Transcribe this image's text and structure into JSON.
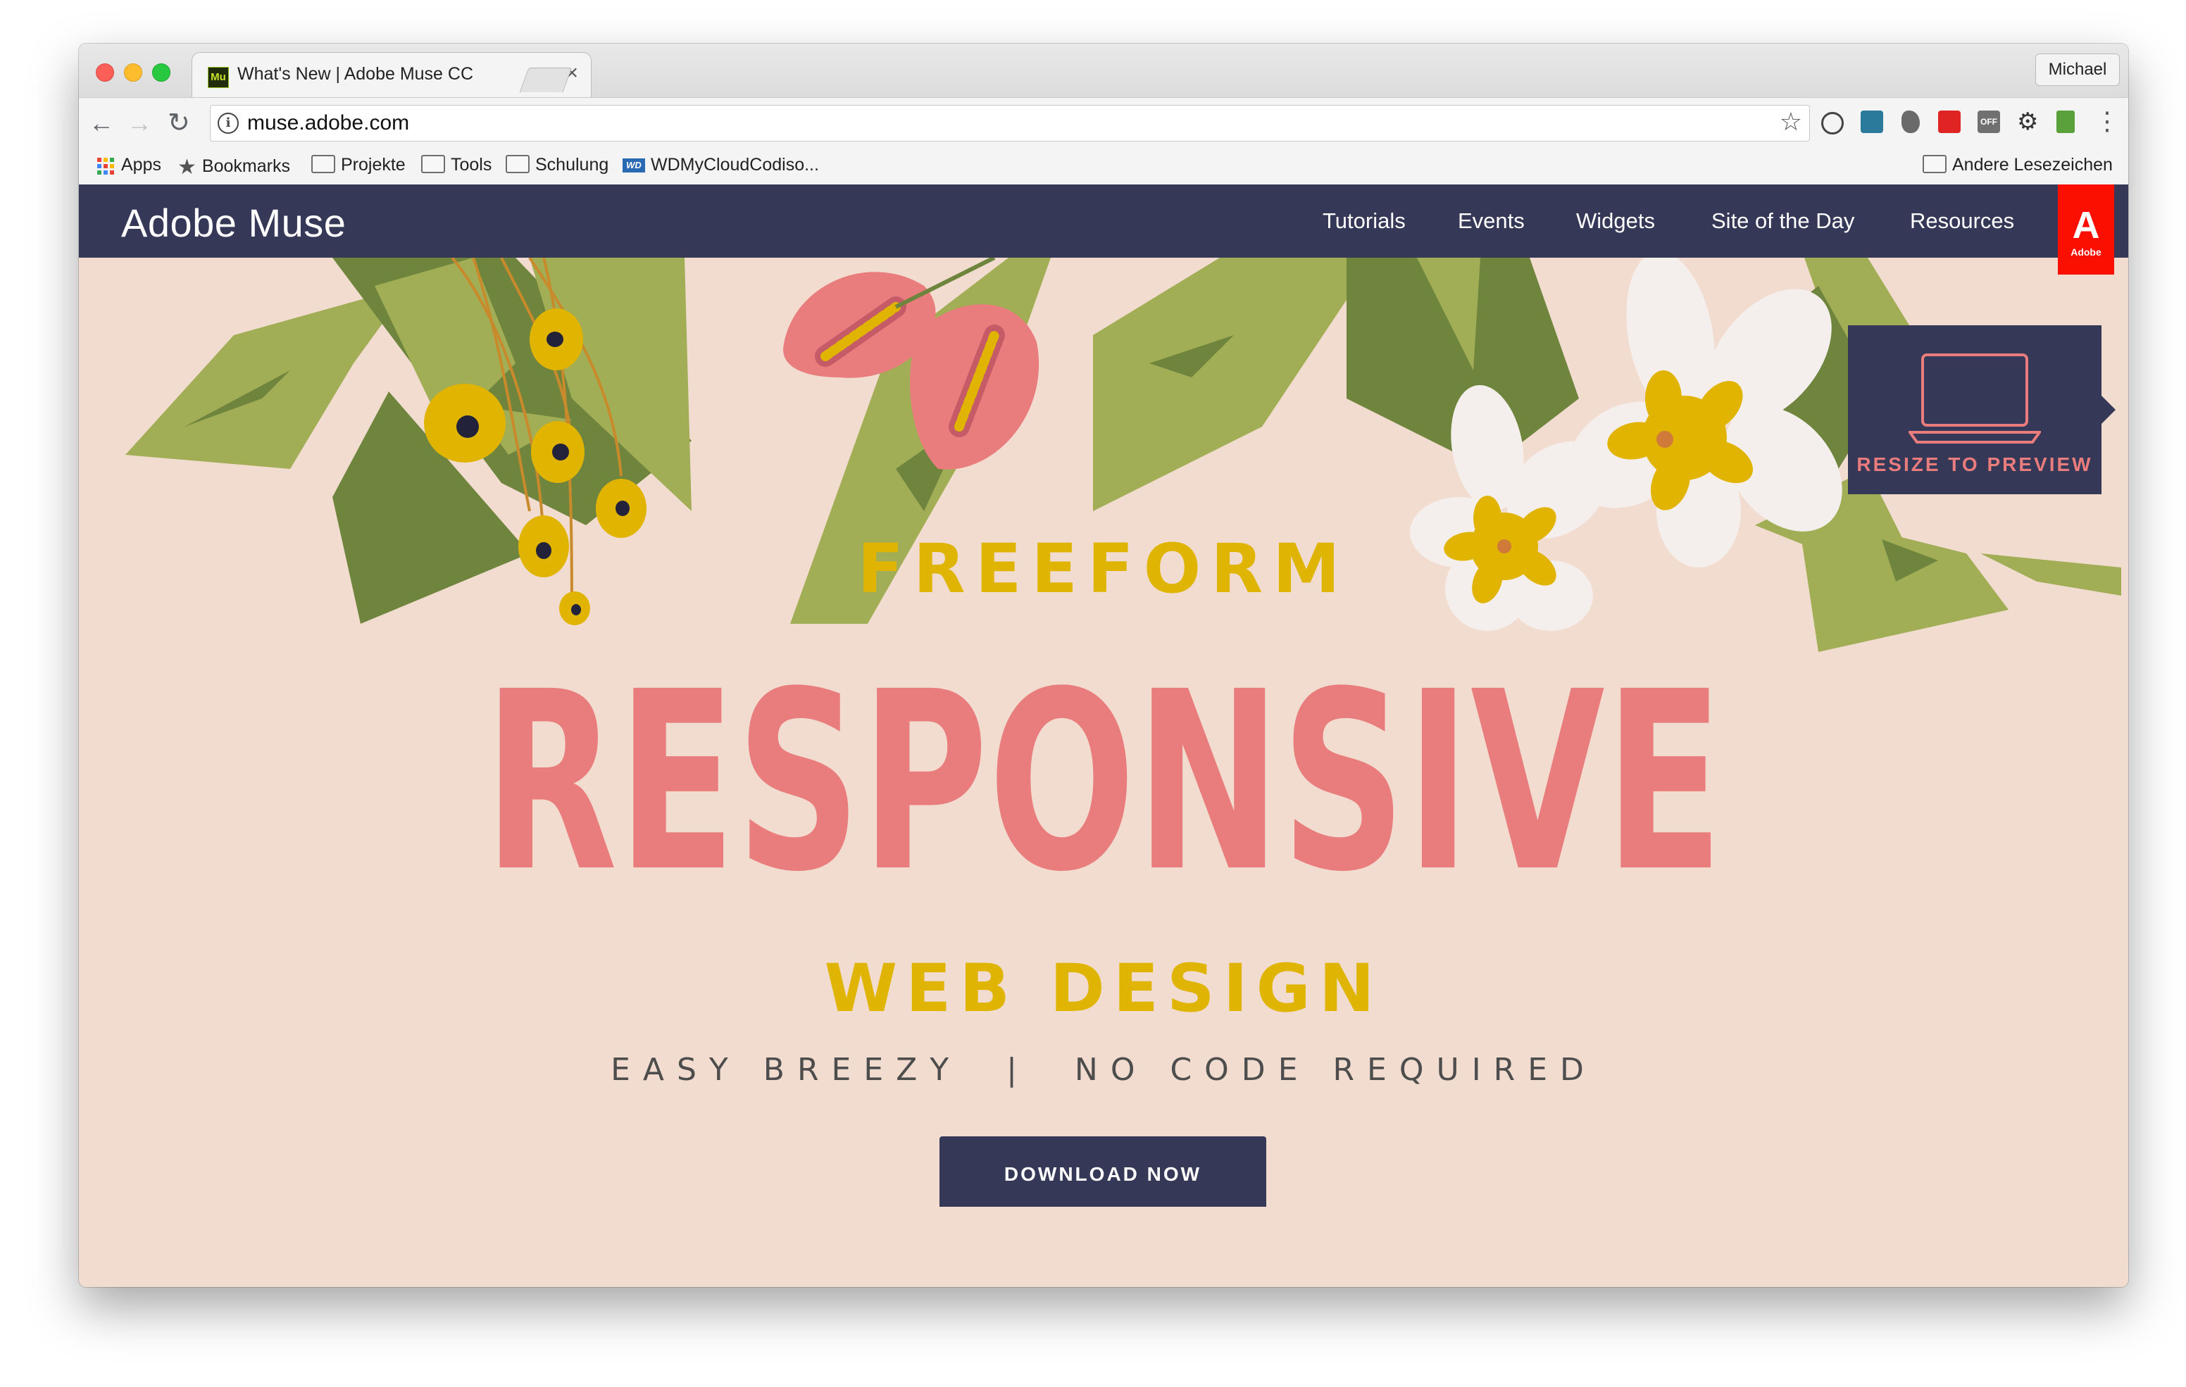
{
  "browser": {
    "tab": {
      "favicon_text": "Mu",
      "title": "What's New | Adobe Muse CC",
      "close": "×"
    },
    "profile": "Michael",
    "address": {
      "url": "muse.adobe.com",
      "info_icon": "i"
    },
    "nav": {
      "back": "←",
      "forward": "→",
      "reload": "↻",
      "bookmark_star": "☆",
      "menu": "⋮"
    },
    "extensions": {
      "off_label": "OFF",
      "gear": "⚙"
    },
    "bookmarks": {
      "items": [
        {
          "label": "Apps",
          "icon": "apps-grid-icon"
        },
        {
          "label": "Bookmarks",
          "icon": "star-icon"
        },
        {
          "label": "Projekte",
          "icon": "folder-icon"
        },
        {
          "label": "Tools",
          "icon": "folder-icon"
        },
        {
          "label": "Schulung",
          "icon": "folder-icon"
        },
        {
          "label": "WDMyCloudCodiso...",
          "icon": "wd-icon"
        }
      ],
      "other": "Andere Lesezeichen",
      "wd_icon_text": "WD"
    }
  },
  "site": {
    "brand": "Adobe Muse",
    "nav": [
      "Tutorials",
      "Events",
      "Widgets",
      "Site of the Day",
      "Resources"
    ],
    "adobe_logo": {
      "glyph": "A",
      "word": "Adobe"
    },
    "resize_card": "RESIZE TO PREVIEW",
    "hero": {
      "line1": "FREEFORM",
      "line2": "RESPONSIVE",
      "line3": "WEB DESIGN",
      "tagline": "EASY BREEZY  |  NO CODE REQUIRED",
      "cta": "DOWNLOAD NOW"
    }
  },
  "colors": {
    "nav_bg": "#363858",
    "hero_bg": "#f2dccf",
    "pink": "#e97c7c",
    "gold": "#dfb403",
    "leaf_light": "#a2ae55",
    "leaf_dark": "#6f853e",
    "adobe_red": "#fa0f00"
  }
}
